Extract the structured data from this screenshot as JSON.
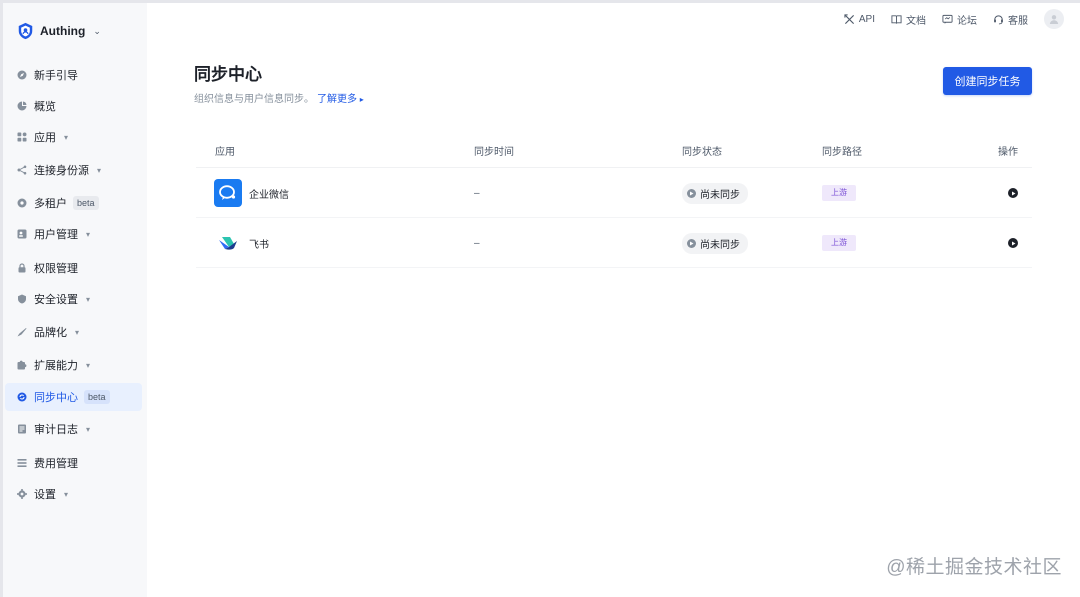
{
  "brand": {
    "name": "Authing"
  },
  "sidebar": {
    "items": [
      {
        "label": "新手引导",
        "icon": "compass-icon",
        "has_arrow": false,
        "beta": ""
      },
      {
        "label": "概览",
        "icon": "pie-chart-icon",
        "has_arrow": false,
        "beta": ""
      },
      {
        "label": "应用",
        "icon": "apps-grid-icon",
        "has_arrow": true,
        "beta": ""
      },
      {
        "label": "连接身份源",
        "icon": "share-icon",
        "has_arrow": true,
        "beta": ""
      },
      {
        "label": "多租户",
        "icon": "tenant-icon",
        "has_arrow": false,
        "beta": "beta"
      },
      {
        "label": "用户管理",
        "icon": "users-icon",
        "has_arrow": true,
        "beta": ""
      },
      {
        "label": "权限管理",
        "icon": "lock-icon",
        "has_arrow": false,
        "beta": ""
      },
      {
        "label": "安全设置",
        "icon": "shield-icon",
        "has_arrow": true,
        "beta": ""
      },
      {
        "label": "品牌化",
        "icon": "brush-icon",
        "has_arrow": true,
        "beta": ""
      },
      {
        "label": "扩展能力",
        "icon": "puzzle-icon",
        "has_arrow": true,
        "beta": ""
      },
      {
        "label": "同步中心",
        "icon": "sync-icon",
        "has_arrow": false,
        "beta": "beta",
        "active": true
      },
      {
        "label": "审计日志",
        "icon": "document-icon",
        "has_arrow": true,
        "beta": ""
      },
      {
        "label": "费用管理",
        "icon": "billing-icon",
        "has_arrow": false,
        "beta": ""
      },
      {
        "label": "设置",
        "icon": "gear-icon",
        "has_arrow": true,
        "beta": ""
      }
    ]
  },
  "topbar": {
    "api": "API",
    "docs": "文档",
    "forum": "论坛",
    "support": "客服"
  },
  "page": {
    "title": "同步中心",
    "subtitle": "组织信息与用户信息同步。",
    "learn_more": "了解更多",
    "create_button": "创建同步任务"
  },
  "table": {
    "headers": {
      "app": "应用",
      "time": "同步时间",
      "status": "同步状态",
      "path": "同步路径",
      "action": "操作"
    },
    "rows": [
      {
        "app": "企业微信",
        "time": "–",
        "status": "尚未同步",
        "path": "上游"
      },
      {
        "app": "飞书",
        "time": "–",
        "status": "尚未同步",
        "path": "上游"
      }
    ]
  },
  "colors": {
    "accent": "#215ae5",
    "tag_bg": "#efe8fb",
    "tag_text": "#7b4fd6"
  },
  "watermark": "@稀土掘金技术社区"
}
